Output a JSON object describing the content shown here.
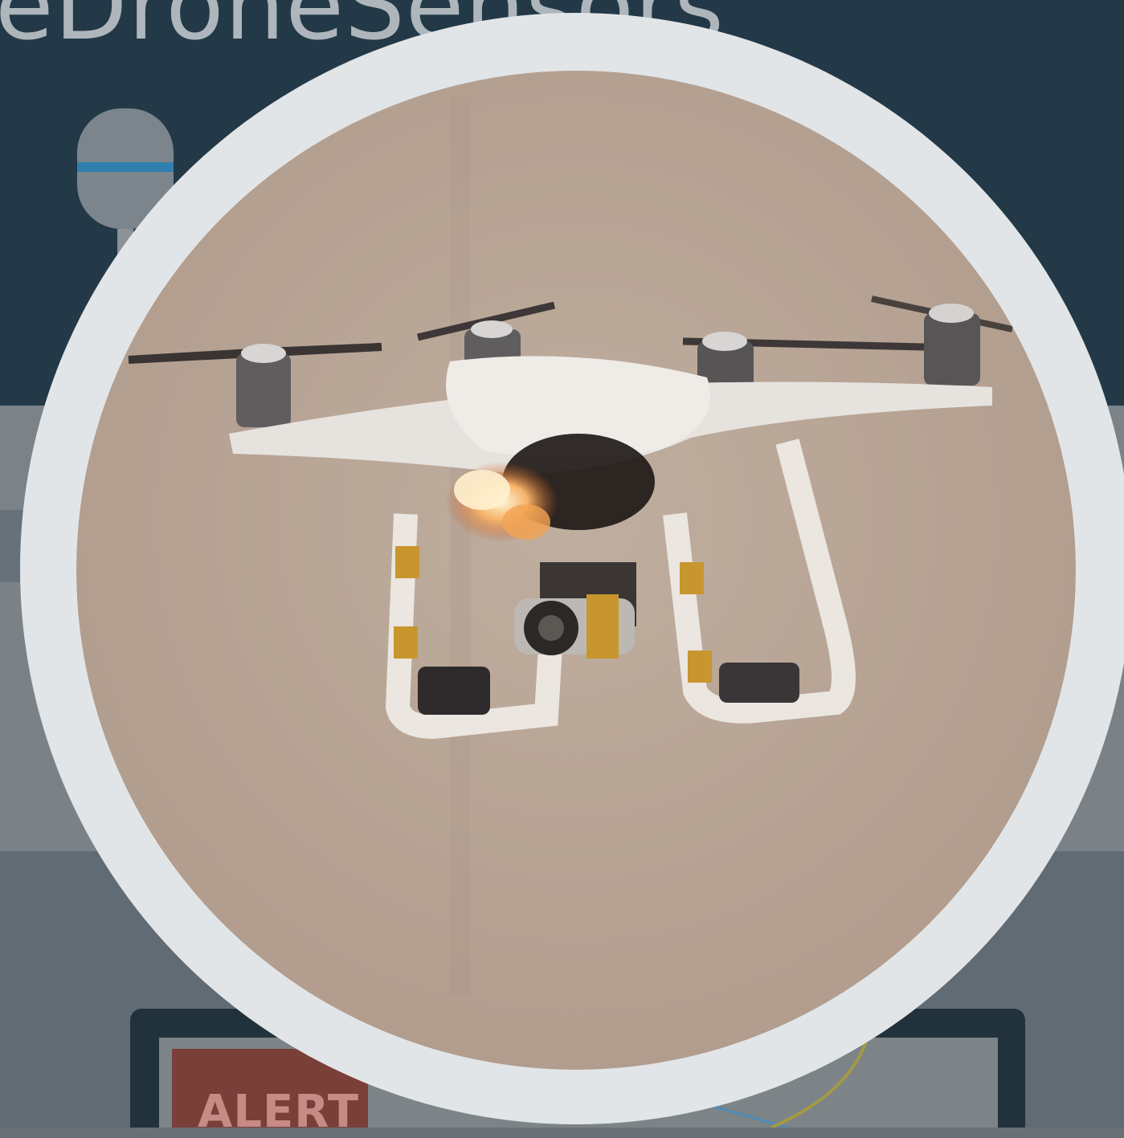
{
  "background": {
    "title_fragment": "eDroneSensors",
    "alert_label": "ALERT",
    "colors": {
      "header": "#233948",
      "panel": "#6a7176",
      "alert": "#7a3f38",
      "ring": "#dfe2e4",
      "photo_bg": "#b5a496"
    }
  },
  "icons": [
    "microphone-icon",
    "drone-icon",
    "flame-icon"
  ]
}
